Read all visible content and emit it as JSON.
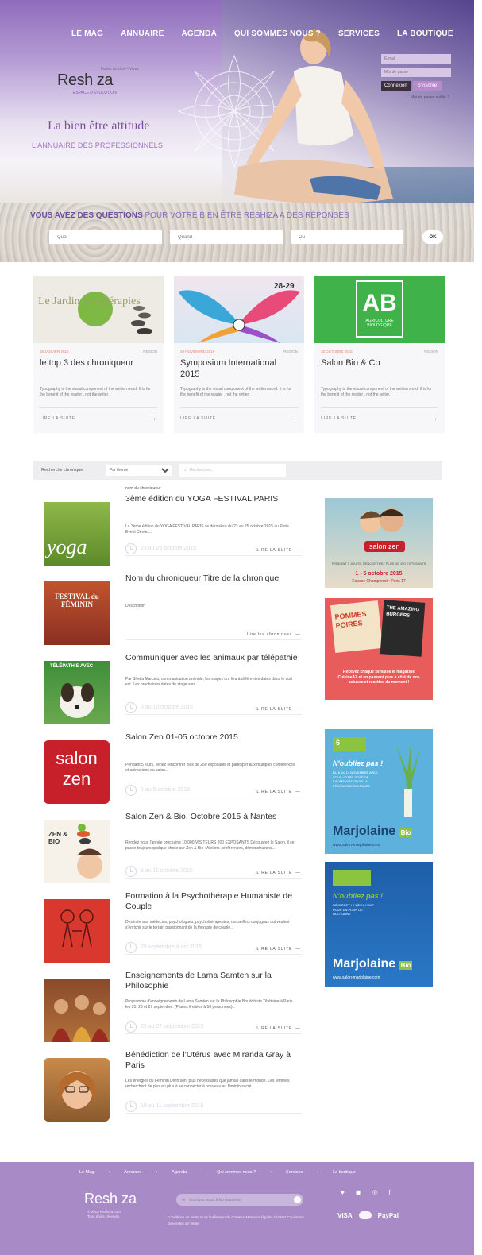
{
  "nav": [
    "LE MAG",
    "ANNUAIRE",
    "AGENDA",
    "QUI SOMMES NOUS ?",
    "SERVICES",
    "LA BOUTIQUE"
  ],
  "login": {
    "email_placeholder": "E-mail",
    "password_placeholder": "Mot de passe",
    "connect": "Connexion",
    "register": "S'inscrire",
    "forgot": "Mot de passe oublié ?"
  },
  "brand": {
    "name": "Resh za",
    "tagline": "Faites un don – Vivez",
    "subtitle": "ESPACE D'ÉVOLUTION",
    "slogan": "La bien être attitude",
    "annuaire": "L'ANNUAIRE DES PROFESSIONNELS"
  },
  "search": {
    "question_bold": "VOUS AVEZ DES QUESTIONS",
    "question_rest": " POUR VOTRE BIEN ÊTRE RESHIZA A DES RÉPONSES",
    "quoi": "Quoi",
    "quand": "Quand",
    "ou": "Où",
    "ok": "OK"
  },
  "cards": [
    {
      "date": "28 JANVIER 2015",
      "cat": "REGION",
      "title": "le top 3 des chroniqueur",
      "text": "Typography is the visual component of the written word. It is for the benefit of the reader , not the writer.",
      "more": "LIRE LA SUITE",
      "img_text": "Le Jardin des thérapies"
    },
    {
      "date": "28 NOVEMBRE 2015",
      "cat": "REGION",
      "title": "Symposium International 2015",
      "text": "Typography is the visual component of the written word. It is for the benefit of the reader , not the writer.",
      "more": "LIRE LA SUITE",
      "img_text": "28-29"
    },
    {
      "date": "28 OCTOBRE 2015",
      "cat": "REGION",
      "title": "Salon Bio & Co",
      "text": "Typography is the visual component of the written word. It is for the benefit of the reader , not the writer.",
      "more": "LIRE LA SUITE",
      "img_text": "AB",
      "img_sub": "AGRICULTURE BIOLOGIQUE"
    }
  ],
  "filter": {
    "label": "Recherche chronique",
    "select": "Par thème",
    "search_placeholder": "Rechercher..."
  },
  "list_top_label": "nom du chroniqueur",
  "items": [
    {
      "title": "3ème édition du YOGA FESTIVAL PARIS",
      "desc": "La 3ème édition du YOGA FESTIVAL PARIS se déroulera du 23 au 25 octobre 2015 au Paris Event Center...",
      "date": "23 au 25 octobre 2015",
      "more": "LIRE LA SUITE",
      "thumb": "yoga"
    },
    {
      "title": "Nom du chroniqueur Titre de la chronique",
      "desc": "Description",
      "date": "",
      "more": "Lire les chroniques",
      "thumb": "FESTIVAL du FÉMININ"
    },
    {
      "title": "Communiquer avec les animaux par télépathie",
      "desc": "Par Sheila Marcelo, communication animale, les stages ont lieu à différentes dates dans le sud est. Les prochaines dates de stage sont...",
      "date": "3 au 10 octobre 2015",
      "more": "LIRE LA SUITE",
      "thumb": "TÉLÉPATHIE AVEC"
    },
    {
      "title": "Salon Zen 01-05 octobre 2015",
      "desc": "Pendant 5 jours, venez rencontrer plus de 250 exposants et participer aux multiples conférences et animations du salon...",
      "date": "1 au 5 octobre 2015",
      "more": "LIRE LA SUITE",
      "thumb": "salon zen"
    },
    {
      "title": "Salon Zen & Bio, Octobre 2015 à Nantes",
      "desc": "Rendez vous l'année prochaine 10 000 VISITEURS 200 EXPOSANTS Découvrez le Salon, il se passe toujours quelque chose sur Zen & Bio : Ateliers-conférences, démonstrations...",
      "date": "9 au 11 octobre 2015",
      "more": "LIRE LA SUITE",
      "thumb": "ZEN & BIO"
    },
    {
      "title": "Formation à la Psychothérapie Humaniste de Couple",
      "desc": "Destinée aux médecins, psychologues, psychothérapeutes, conseillers conjugaux qui veulent s'enrichir sur le terrain passionnant de la thérapie de couple...",
      "date": "26 septembre à oct 2015",
      "more": "LIRE LA SUITE",
      "thumb": "couple"
    },
    {
      "title": "Enseignements de Lama Samten sur la Philosophie",
      "desc": "Programme d'enseignements de Lama Samten sur la Philosophie Bouddhiste Tibétaine à Paris les 25, 26 et 27 septembre. (Places limitées à 50 personnes)...",
      "date": "25 au 27 septembre 2015",
      "more": "LIRE LA SUITE",
      "thumb": "lama"
    },
    {
      "title": "Bénédiction de l'Utérus avec Miranda Gray à Paris",
      "desc": "Les énergies du Féminin Divin sont plus nécessaires que jamais dans le monde. Les femmes recherchent de plus en plus à se connecter à nouveau au féminin sacré...",
      "date": "10 au 11 septembre 2015",
      "more": "LIRE LA SUITE",
      "thumb": "miranda"
    }
  ],
  "ads": [
    {
      "top": "salon zen",
      "text": "PENDANT 5 JOURS, RENCONTREZ PLUS DE 250 EXPOSANTS",
      "date": "1 - 5 octobre 2015",
      "place": "Espace Champerret • Paris 17"
    },
    {
      "top": "POMMES POIRES",
      "top2": "THE AMAZING BURGERS",
      "text": "Recevez chaque semaine le magazine CuisineAZ et en passant plus à côté de nos astuces et recettes du moment !"
    },
    {
      "top": "N'oubliez pas !",
      "text": "DU 6 AU 14 NOVEMBRE AVEZ-VOUS VOTRE DOSE DE L'ALIMENTATION BIO & L'ÉCONOMIE SOLIDAIRE",
      "brand": "Marjolaine",
      "brand_sub": "Bio",
      "url": "www.salon-marjolaine.com"
    },
    {
      "top": "N'oubliez pas !",
      "text": "DÉVERSEZ LA MEGA LUNE POUR UN PLEIN DE NOCTURNE",
      "brand": "Marjolaine",
      "brand_sub": "Bio",
      "url": "www.salon-marjolaine.com"
    }
  ],
  "footer": {
    "nav": [
      "Le Mag",
      "Annuaire",
      "Agenda",
      "Qui sommes nous ?",
      "Services",
      "La boutique"
    ],
    "logo": "Resh za",
    "copy": "© 2015 Reshiza.com",
    "copy2": "Tous droits réservés",
    "newsletter_placeholder": "Inscrivez-vous à la newsletter",
    "links": "Conditions de vente et de l'utilisation du Contenu   Mentions légales   Contact   Conditions Générales de Vente",
    "social": [
      "♥",
      "▣",
      "℗",
      "f"
    ],
    "pay": [
      "VISA",
      "PayPal"
    ]
  },
  "colors": {
    "accent": "#7b4e9c",
    "footer": "#a88ac6",
    "light_purple": "#d8c6e6"
  }
}
